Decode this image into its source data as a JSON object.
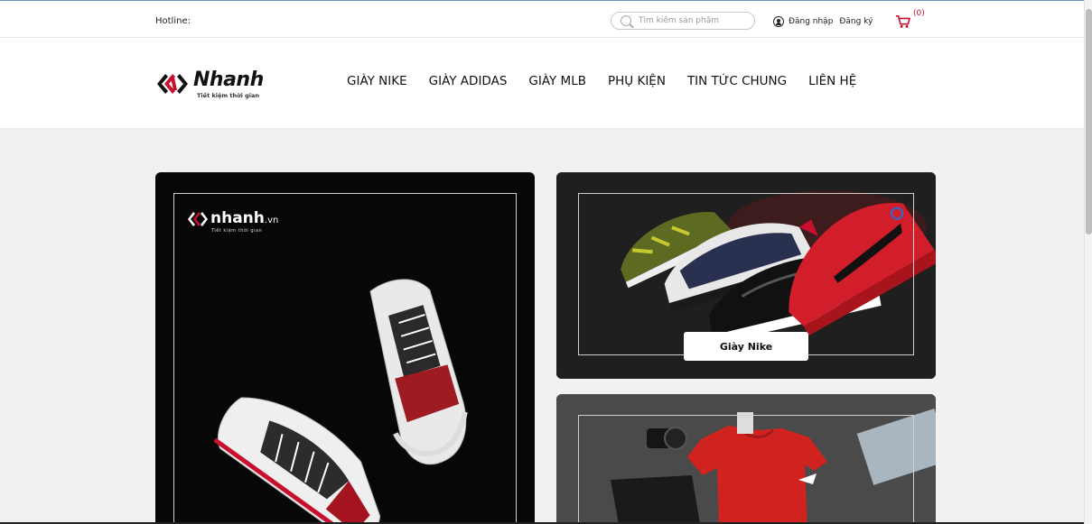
{
  "topbar": {
    "hotline_label": "Hotline:",
    "search_placeholder": "Tìm kiếm sản phẩm",
    "login_label": "Đăng nhập",
    "register_label": "Đăng ký",
    "cart_count": "(0)"
  },
  "header": {
    "brand": "Nhanh",
    "tagline": "Tiết kiệm thời gian",
    "nav": [
      "GIÀY NIKE",
      "GIÀY ADIDAS",
      "GIÀY MLB",
      "PHỤ KIỆN",
      "TIN TỨC CHUNG",
      "LIÊN HỆ"
    ]
  },
  "cards": {
    "left_watermark": "nhanh",
    "left_watermark_suffix": ".vn",
    "left_watermark_tagline": "Tiết kiệm thời gian",
    "right1_button": "Giày Nike"
  },
  "colors": {
    "brand_red": "#c8102e",
    "content_bg": "#f1f1f1"
  },
  "icons": [
    "search-icon",
    "user-icon",
    "cart-icon",
    "logo-mark-icon"
  ]
}
